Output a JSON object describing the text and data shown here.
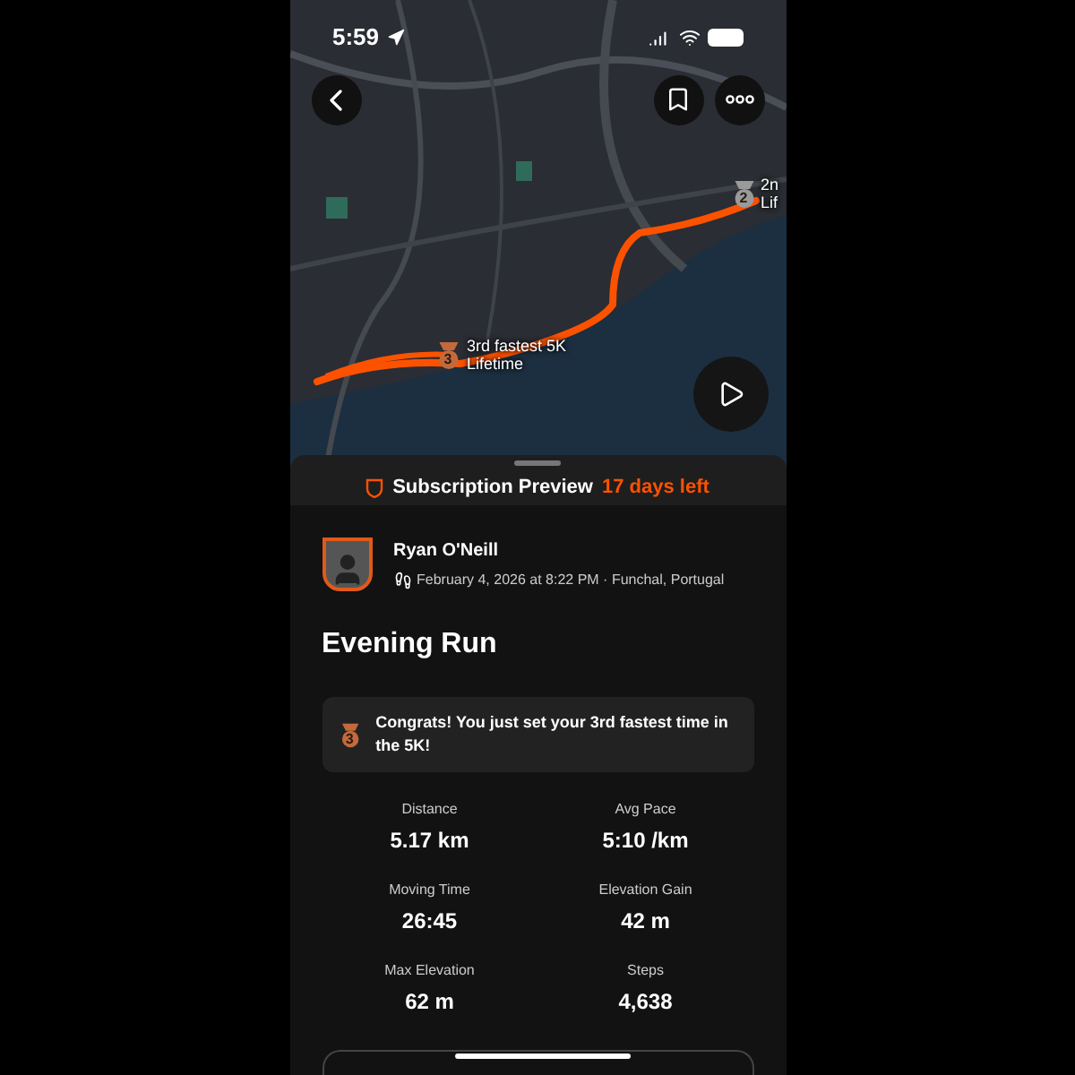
{
  "status_bar": {
    "time": "5:59"
  },
  "map": {
    "markers": [
      {
        "rank": "2",
        "line_1": "2n",
        "line_2": "Lif"
      },
      {
        "rank": "3",
        "line_1": "3rd fastest 5K",
        "line_2": "Lifetime"
      }
    ]
  },
  "subscription": {
    "label": "Subscription Preview",
    "remaining": "17 days left"
  },
  "athlete": {
    "name": "Ryan O'Neill",
    "meta": "February 4, 2026 at 8:22 PM · Funchal, Portugal"
  },
  "activity": {
    "title": "Evening Run"
  },
  "achievement": {
    "rank": "3",
    "text": "Congrats! You just set your 3rd fastest time in the 5K!"
  },
  "stats": [
    {
      "label": "Distance",
      "value": "5.17 km"
    },
    {
      "label": "Avg Pace",
      "value": "5:10 /km"
    },
    {
      "label": "Moving Time",
      "value": "26:45"
    },
    {
      "label": "Elevation Gain",
      "value": "42 m"
    },
    {
      "label": "Max Elevation",
      "value": "62 m"
    },
    {
      "label": "Steps",
      "value": "4,638"
    }
  ]
}
